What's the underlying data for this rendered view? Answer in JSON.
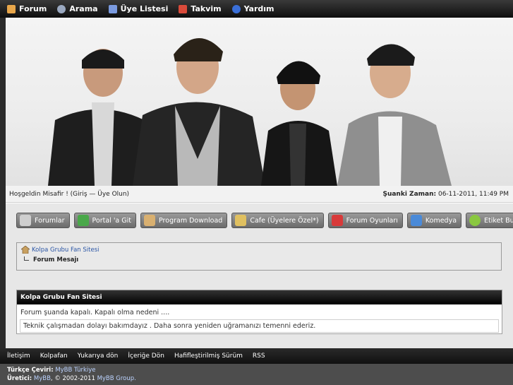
{
  "nav": {
    "items": [
      {
        "label": "Forum",
        "icon": "clipboard-icon",
        "color": "#e8a64a"
      },
      {
        "label": "Arama",
        "icon": "search-icon",
        "color": "#9aa8c0"
      },
      {
        "label": "Üye Listesi",
        "icon": "users-icon",
        "color": "#7a9adf"
      },
      {
        "label": "Takvim",
        "icon": "calendar-icon",
        "color": "#d94a3a"
      },
      {
        "label": "Yardım",
        "icon": "help-icon",
        "color": "#3a6fd8"
      }
    ]
  },
  "welcome": {
    "greeting": "Hoşgeldin Misafir ! (Giriş — Üye Olun)",
    "time_label": "Şuanki Zaman:",
    "time_value": "06-11-2011, 11:49 PM"
  },
  "menu": {
    "buttons": [
      {
        "label": "Forumlar",
        "icon": "forum-icon",
        "color": "#cfcfcf"
      },
      {
        "label": "Portal 'a Git",
        "icon": "portal-icon",
        "color": "#4aa84a"
      },
      {
        "label": "Program Download",
        "icon": "download-icon",
        "color": "#d9b070"
      },
      {
        "label": "Cafe (Üyelere Özel*)",
        "icon": "cafe-icon",
        "color": "#e0c060"
      },
      {
        "label": "Forum Oyunları",
        "icon": "games-icon",
        "color": "#d83a3a"
      },
      {
        "label": "Komedya",
        "icon": "comedy-icon",
        "color": "#4a8ad8"
      },
      {
        "label": "Etiket Bulutu",
        "icon": "tag-cloud-icon",
        "color": "#8ac840"
      }
    ]
  },
  "breadcrumb": {
    "root": "Kolpa Grubu Fan Sitesi",
    "current": "Forum Mesajı"
  },
  "message": {
    "title": "Kolpa Grubu Fan Sitesi",
    "closed_text": "Forum şuanda kapalı. Kapalı olma nedeni ....",
    "reason": "Teknik çalışmadan dolayı bakımdayız . Daha sonra yeniden uğramanızı temenni ederiz."
  },
  "footer": {
    "links": [
      "İletişim",
      "Kolpafan",
      "Yukarıya dön",
      "İçeriğe Dön",
      "Hafifleştirilmiş Sürüm",
      "RSS"
    ]
  },
  "copyright": {
    "translation_label": "Türkçe Çeviri:",
    "translation_value": "MyBB Türkiye",
    "producer_label": "Üretici:",
    "producer_value_1": "MyBB",
    "producer_value_2": ", © 2002-2011 ",
    "producer_value_3": "MyBB Group."
  },
  "colors": {
    "nav_bg": "#1a1a1a",
    "link_blue": "#2a55a5"
  }
}
